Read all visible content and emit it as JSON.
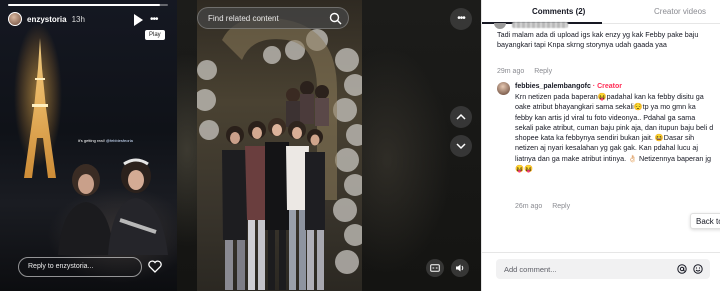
{
  "story": {
    "username": "enzystoria",
    "time": "13h",
    "tooltip": "Play",
    "caption": "it's getting real!",
    "caption_tag": "@febbiesfeoria",
    "reply_placeholder": "Reply to enzystoria...",
    "progress": 0.95,
    "icons": [
      "play-icon",
      "more-icon",
      "heart-icon"
    ]
  },
  "video": {
    "search_placeholder": "Find related content",
    "icons": [
      "search-icon",
      "more-icon",
      "chevron-up-icon",
      "chevron-down-icon",
      "captions-icon",
      "volume-icon"
    ]
  },
  "panel": {
    "tabs": [
      {
        "label": "Comments (2)"
      },
      {
        "label": "Creator videos"
      }
    ],
    "comment1": {
      "text": "Tadi malam ada di upload igs kak enzy yg kak Febby pake baju bayangkari tapi Knpa skrng storynya udah gaada yaa",
      "time": "29m ago",
      "reply": "Reply"
    },
    "comment2": {
      "author": "febbies_palembangofc",
      "creator_label": " · Creator",
      "text": "Krn netizen pada baperan😝padahal kan ka febby disitu ga oake atribut bhayangkari sama sekali😌tp ya mo gmn ka febby kan artis jd viral tu foto videonya.. Pdahal ga sama sekali pake atribut, cuman baju pink aja, dan itupun baju beli d shopee kata ka febbynya sendiri bukan jait. 😆Dasar sih netizen aj nyari kesalahan yg gak gak. Kan pdahal lucu aj liatnya dan ga make atribut intinya. 👌🏻 Netizennya baperan jg😝😝",
      "time": "26m ago",
      "reply": "Reply"
    },
    "back_button": "Back to",
    "add_comment_placeholder": "Add comment...",
    "icons": [
      "mention-icon",
      "emoji-icon"
    ]
  },
  "colors": {
    "creator_accent": "#fe2c55",
    "text_primary": "#161823",
    "text_secondary": "#8a8b91"
  }
}
